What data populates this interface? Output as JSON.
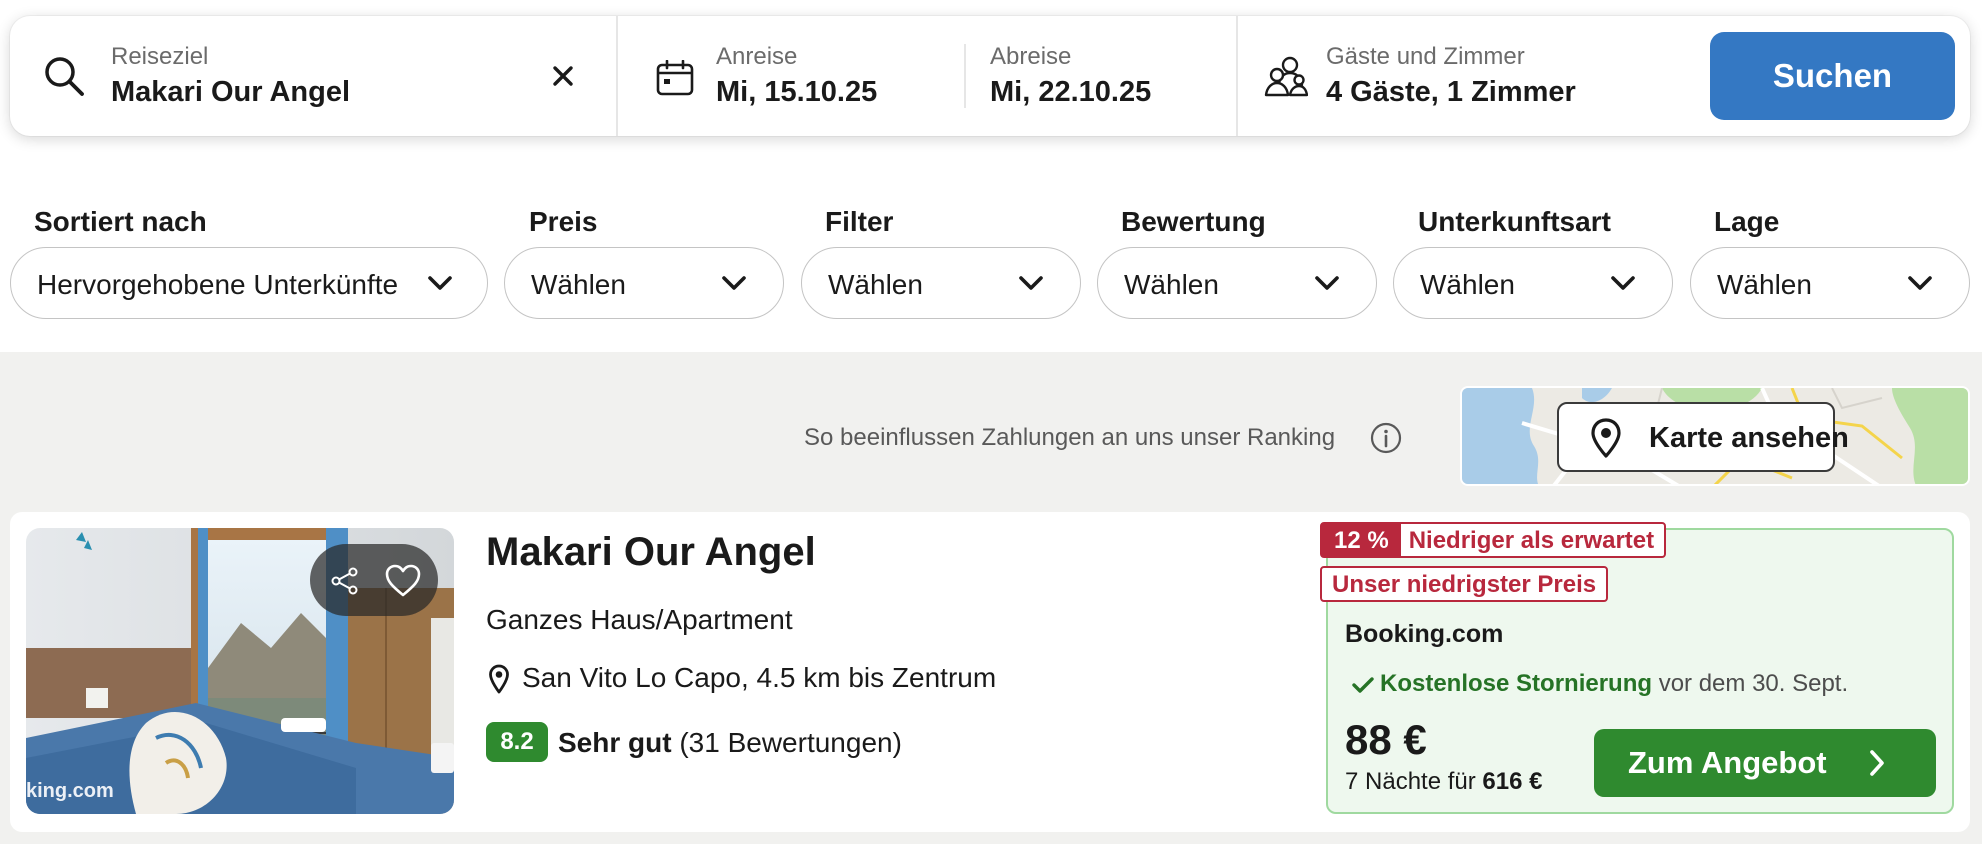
{
  "search": {
    "destination_label": "Reiseziel",
    "destination_value": "Makari Our Angel",
    "checkin_label": "Anreise",
    "checkin_value": "Mi, 15.10.25",
    "checkout_label": "Abreise",
    "checkout_value": "Mi, 22.10.25",
    "guests_label": "Gäste und Zimmer",
    "guests_value": "4 Gäste, 1 Zimmer",
    "search_button": "Suchen"
  },
  "filters": [
    {
      "label": "Sortiert nach",
      "value": "Hervorgehobene Unterkünfte"
    },
    {
      "label": "Preis",
      "value": "Wählen"
    },
    {
      "label": "Filter",
      "value": "Wählen"
    },
    {
      "label": "Bewertung",
      "value": "Wählen"
    },
    {
      "label": "Unterkunftsart",
      "value": "Wählen"
    },
    {
      "label": "Lage",
      "value": "Wählen"
    }
  ],
  "ranking_note": "So beeinflussen Zahlungen an uns unser Ranking",
  "map_button": "Karte ansehen",
  "result": {
    "title": "Makari Our Angel",
    "property_type": "Ganzes Haus/Apartment",
    "location": "San Vito Lo Capo, 4.5 km bis Zentrum",
    "score": "8.2",
    "score_label": "Sehr gut",
    "reviews": "(31 Bewertungen)",
    "photo_watermark": "king.com",
    "offer": {
      "discount_pct": "12 %",
      "discount_text": "Niedriger als erwartet",
      "lowest_price_badge": "Unser niedrigster Preis",
      "provider": "Booking.com",
      "cancellation_bold": "Kostenlose Stornierung",
      "cancellation_rest": "vor dem 30. Sept.",
      "price": "88 €",
      "total_prefix": "7 Nächte für",
      "total_value": "616 €",
      "cta": "Zum Angebot"
    }
  },
  "colors": {
    "primary_blue": "#3478c3",
    "green": "#2f8a2f",
    "deal_red": "#b8283d",
    "offer_bg": "#eef8ee"
  },
  "icons": [
    "search-icon",
    "clear-icon",
    "calendar-icon",
    "guests-icon",
    "chevron-down-icon",
    "info-icon",
    "map-pin-icon",
    "share-icon",
    "heart-icon",
    "location-pin-icon",
    "check-icon",
    "chevron-right-icon"
  ]
}
